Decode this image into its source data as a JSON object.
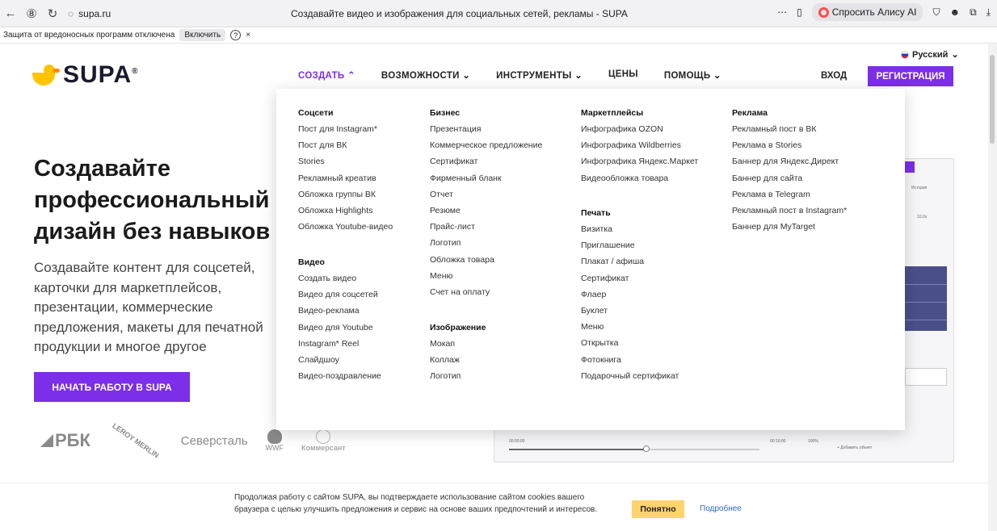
{
  "browser": {
    "url": "supa.ru",
    "page_title": "Создавайте видео и изображения для социальных сетей, рекламы - SUPA",
    "alice_label": "Спросить Алису AI",
    "more": "⋯"
  },
  "warning": {
    "text": "Защита от вредоносных программ отключена",
    "enable_label": "Включить",
    "help": "?",
    "close": "×"
  },
  "header": {
    "logo": "SUPA",
    "logo_mark": "®",
    "language": "Русский",
    "nav": [
      "СОЗДАТЬ",
      "ВОЗМОЖНОСТИ",
      "ИНСТРУМЕНТЫ",
      "ЦЕНЫ",
      "ПОМОЩЬ"
    ],
    "login": "ВХОД",
    "register": "РЕГИСТРАЦИЯ"
  },
  "hero": {
    "title_lines": [
      "Создавайте",
      "профессиональный",
      "дизайн без навыков"
    ],
    "subtitle_lines": [
      "Создавайте контент для соцсетей,",
      "карточки для маркетплейсов,",
      "презентации, коммерческие",
      "предложения, макеты для печатной",
      "продукции и многое другое"
    ],
    "cta": "НАЧАТЬ РАБОТУ В SUPA"
  },
  "brands": [
    "РБК",
    "LEROY MERLIN",
    "Северсталь",
    "WWF",
    "Коммерсант"
  ],
  "menu": {
    "socials_title": "Соцсети",
    "socials": [
      "Пост для Instagram*",
      "Пост для ВК",
      "Stories",
      "Рекламный креатив",
      "Обложка группы ВК",
      "Обложка Highlights",
      "Обложка Youtube-видео"
    ],
    "video_title": "Видео",
    "video": [
      "Создать видео",
      "Видео для соцсетей",
      "Видео-реклама",
      "Видео для Youtube",
      "Instagram* Reel",
      "Слайдшоу",
      "Видео-поздравление"
    ],
    "business_title": "Бизнес",
    "business": [
      "Презентация",
      "Коммерческое предложение",
      "Сертификат",
      "Фирменный бланк",
      "Отчет",
      "Резюме",
      "Прайс-лист",
      "Логотип",
      "Обложка товара",
      "Меню",
      "Счет на оплату"
    ],
    "image_title": "Изображение",
    "image": [
      "Мокап",
      "Коллаж",
      "Логотип"
    ],
    "market_title": "Маркетплейсы",
    "market": [
      "Инфографика OZON",
      "Инфографика Wildberries",
      "Инфографика Яндекс.Маркет",
      "Видеообложка товара"
    ],
    "print_title": "Печать",
    "print": [
      "Визитка",
      "Приглашение",
      "Плакат / афиша",
      "Сертификат",
      "Флаер",
      "Буклет",
      "Меню",
      "Открытка",
      "Фотокнига",
      "Подарочный сертификат"
    ],
    "ads_title": "Реклама",
    "ads": [
      "Рекламный пост в ВК",
      "Реклама в Stories",
      "Баннер для Яндекс.Директ",
      "Баннер для сайта",
      "Реклама в Telegram",
      "Рекламный пост в Instagram*",
      "Баннер для MyTarget"
    ]
  },
  "cookie": {
    "text": "Продолжая работу с сайтом SUPA, вы подтверждаете использование сайтом cookies вашего браузера с целью улучшить предложения и сервис на основе ваших предпочтений и интересов.",
    "ok": "Понятно",
    "more": "Подробнее"
  },
  "mock": {
    "history": "История",
    "duration": "10.0s",
    "add_object": "+ Добавить объект",
    "time_start": "00:00:00",
    "time_end": "00:10:00",
    "zoom": "100%"
  }
}
